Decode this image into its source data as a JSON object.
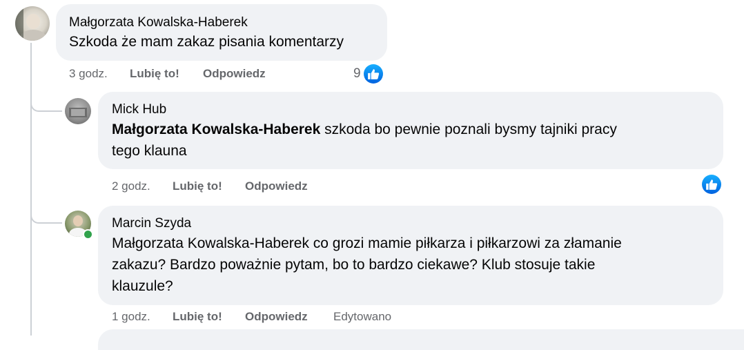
{
  "comments": [
    {
      "author": "Małgorzata Kowalska-Haberek",
      "text": "Szkoda że mam zakaz pisania komentarzy",
      "time": "3 godz.",
      "like_label": "Lubię to!",
      "reply_label": "Odpowiedz",
      "reaction_count": "9"
    },
    {
      "author": "Mick Hub",
      "mention": "Małgorzata Kowalska-Haberek",
      "text_line1": " szkoda bo pewnie poznali bysmy tajniki pracy",
      "text_line2": "tego klauna",
      "time": "2 godz.",
      "like_label": "Lubię to!",
      "reply_label": "Odpowiedz"
    },
    {
      "author": "Marcin Szyda",
      "text_line1": "Małgorzata Kowalska-Haberek co grozi mamie piłkarza i piłkarzowi za złamanie",
      "text_line2": "zakazu? Bardzo poważnie pytam, bo to bardzo ciekawe? Klub stosuje takie",
      "text_line3": "klauzule?",
      "time": "1 godz.",
      "like_label": "Lubię to!",
      "reply_label": "Odpowiedz",
      "edited_label": "Edytowano"
    }
  ],
  "colors": {
    "bubble": "#f0f2f5",
    "meta_text": "#65676b",
    "like_blue": "#0866ff",
    "online_green": "#31a24c"
  }
}
